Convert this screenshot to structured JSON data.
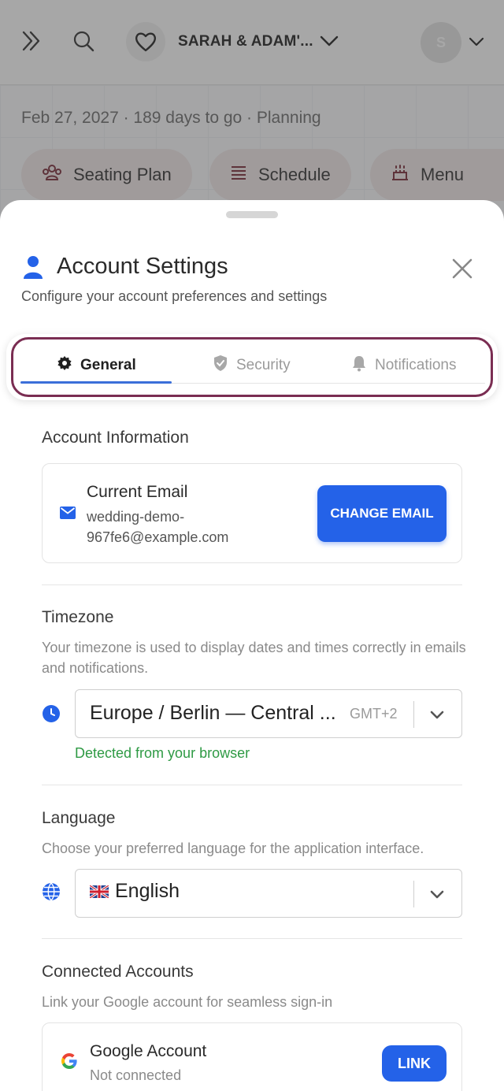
{
  "topbar": {
    "couple_name": "SARAH & ADAM'...",
    "avatar_initial": "S"
  },
  "background": {
    "date_line": "Feb 27, 2027 · 189 days to go · Planning",
    "pills": [
      {
        "label": "Seating Plan",
        "icon": "people-icon"
      },
      {
        "label": "Schedule",
        "icon": "list-icon"
      },
      {
        "label": "Menu",
        "icon": "cake-icon"
      }
    ]
  },
  "sheet": {
    "title": "Account Settings",
    "subtitle": "Configure your account preferences and settings",
    "tabs": [
      {
        "label": "General",
        "active": true
      },
      {
        "label": "Security",
        "active": false
      },
      {
        "label": "Notifications",
        "active": false
      }
    ],
    "account_info": {
      "heading": "Account Information",
      "email_label": "Current Email",
      "email_value": "wedding-demo-967fe6@example.com",
      "change_button": "CHANGE EMAIL"
    },
    "timezone": {
      "heading": "Timezone",
      "description": "Your timezone is used to display dates and times correctly in emails and notifications.",
      "value": "Europe / Berlin — Central ...",
      "offset": "GMT+2",
      "hint": "Detected from your browser"
    },
    "language": {
      "heading": "Language",
      "description": "Choose your preferred language for the application interface.",
      "value": "English"
    },
    "connected": {
      "heading": "Connected Accounts",
      "description": "Link your Google account for seamless sign-in",
      "google_title": "Google Account",
      "google_status": "Not connected",
      "link_button": "LINK"
    }
  },
  "colors": {
    "accent": "#2462e8",
    "tab_ring": "#7a2d52",
    "success": "#2e9a44"
  }
}
